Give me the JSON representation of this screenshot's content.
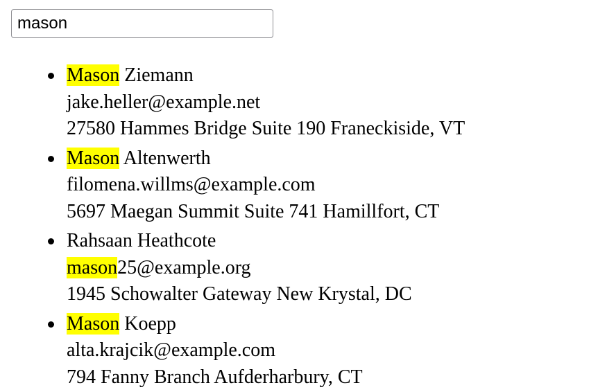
{
  "search": {
    "value": "mason",
    "placeholder": ""
  },
  "results": [
    {
      "name": {
        "pre": "",
        "match": "Mason",
        "post": " Ziemann"
      },
      "email": {
        "pre": "",
        "match": "",
        "post": "jake.heller@example.net"
      },
      "address": "27580 Hammes Bridge Suite 190 Franeckiside, VT"
    },
    {
      "name": {
        "pre": "",
        "match": "Mason",
        "post": " Altenwerth"
      },
      "email": {
        "pre": "",
        "match": "",
        "post": "filomena.willms@example.com"
      },
      "address": "5697 Maegan Summit Suite 741 Hamillfort, CT"
    },
    {
      "name": {
        "pre": "",
        "match": "",
        "post": "Rahsaan Heathcote"
      },
      "email": {
        "pre": "",
        "match": "mason",
        "post": "25@example.org"
      },
      "address": "1945 Schowalter Gateway New Krystal, DC"
    },
    {
      "name": {
        "pre": "",
        "match": "Mason",
        "post": " Koepp"
      },
      "email": {
        "pre": "",
        "match": "",
        "post": "alta.krajcik@example.com"
      },
      "address": "794 Fanny Branch Aufderharbury, CT"
    }
  ],
  "colors": {
    "highlight": "#ffff00"
  }
}
